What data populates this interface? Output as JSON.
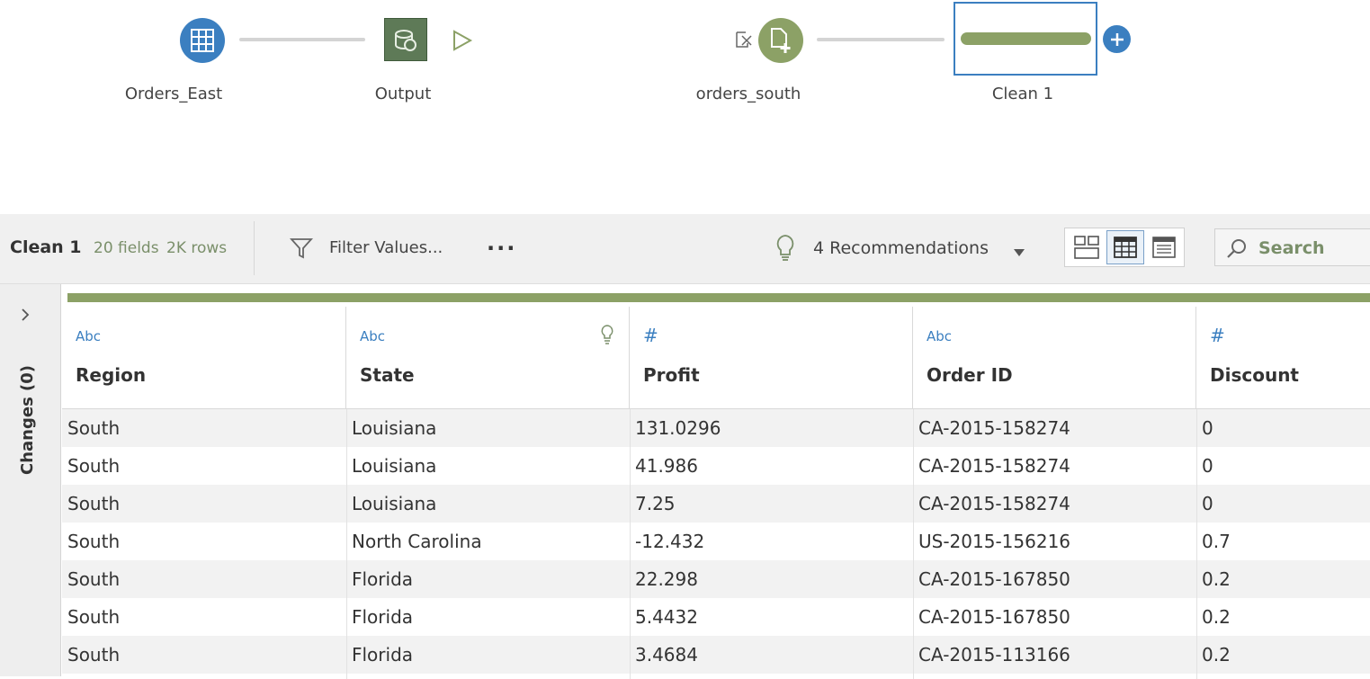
{
  "flow": {
    "nodes": [
      {
        "label": "Orders_East",
        "icon": "table-icon"
      },
      {
        "label": "Output",
        "icon": "output-icon"
      },
      {
        "label": "orders_south",
        "icon": "file-add-icon"
      },
      {
        "label": "Clean 1",
        "icon": "clean-step-icon"
      }
    ]
  },
  "toolbar": {
    "title": "Clean 1",
    "fields": "20 fields",
    "rows": "2K rows",
    "filter_label": "Filter Values...",
    "more": "...",
    "recommendations": "4 Recommendations",
    "search_label": "Search"
  },
  "sidebar": {
    "changes_label": "Changes (0)"
  },
  "grid": {
    "columns": [
      {
        "type": "Abc",
        "name": "Region"
      },
      {
        "type": "Abc",
        "name": "State"
      },
      {
        "type": "#",
        "name": "Profit"
      },
      {
        "type": "Abc",
        "name": "Order ID"
      },
      {
        "type": "#",
        "name": "Discount"
      }
    ],
    "rows": [
      [
        "South",
        "Louisiana",
        "131.0296",
        "CA-2015-158274",
        "0"
      ],
      [
        "South",
        "Louisiana",
        "41.986",
        "CA-2015-158274",
        "0"
      ],
      [
        "South",
        "Louisiana",
        "7.25",
        "CA-2015-158274",
        "0"
      ],
      [
        "South",
        "North Carolina",
        "-12.432",
        "US-2015-156216",
        "0.7"
      ],
      [
        "South",
        "Florida",
        "22.298",
        "CA-2015-167850",
        "0.2"
      ],
      [
        "South",
        "Florida",
        "5.4432",
        "CA-2015-167850",
        "0.2"
      ],
      [
        "South",
        "Florida",
        "3.4684",
        "CA-2015-113166",
        "0.2"
      ]
    ]
  },
  "colors": {
    "accent_blue": "#3b7fc0",
    "accent_green": "#8ca166",
    "meta_green": "#7a8f6a"
  }
}
